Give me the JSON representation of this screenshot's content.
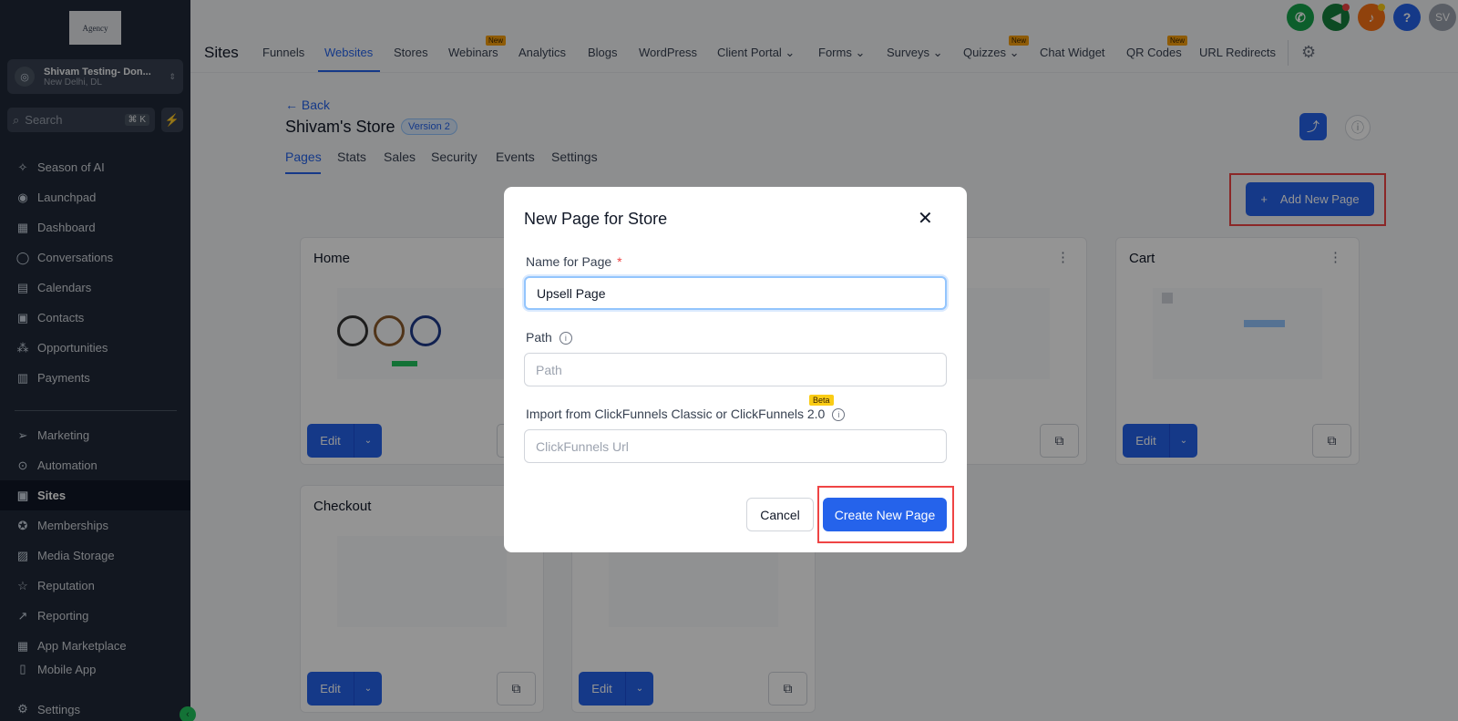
{
  "sidebar": {
    "logo_text": "Agency",
    "account": {
      "name": "Shivam Testing- Don...",
      "location": "New Delhi, DL"
    },
    "search": {
      "placeholder": "Search",
      "shortcut": "⌘ K"
    },
    "items": [
      {
        "label": "Season of AI",
        "icon": "sparkle-icon"
      },
      {
        "label": "Launchpad",
        "icon": "rocket-icon"
      },
      {
        "label": "Dashboard",
        "icon": "grid-icon"
      },
      {
        "label": "Conversations",
        "icon": "chat-icon"
      },
      {
        "label": "Calendars",
        "icon": "calendar-icon"
      },
      {
        "label": "Contacts",
        "icon": "contacts-icon"
      },
      {
        "label": "Opportunities",
        "icon": "funnel-icon"
      },
      {
        "label": "Payments",
        "icon": "payments-icon"
      },
      {
        "label": "Marketing",
        "icon": "send-icon"
      },
      {
        "label": "Automation",
        "icon": "automation-icon"
      },
      {
        "label": "Sites",
        "icon": "sites-icon",
        "active": true
      },
      {
        "label": "Memberships",
        "icon": "badge-icon"
      },
      {
        "label": "Media Storage",
        "icon": "image-icon"
      },
      {
        "label": "Reputation",
        "icon": "star-icon"
      },
      {
        "label": "Reporting",
        "icon": "chart-icon"
      },
      {
        "label": "App Marketplace",
        "icon": "apps-icon"
      },
      {
        "label": "Mobile App",
        "icon": "phone-icon"
      },
      {
        "label": "Settings",
        "icon": "gear-icon"
      }
    ]
  },
  "topbar": {
    "title": "Sites",
    "nav": [
      {
        "label": "Funnels"
      },
      {
        "label": "Websites",
        "active": true
      },
      {
        "label": "Stores"
      },
      {
        "label": "Webinars",
        "badge": "New"
      },
      {
        "label": "Analytics"
      },
      {
        "label": "Blogs"
      },
      {
        "label": "WordPress"
      },
      {
        "label": "Client Portal ⌄"
      },
      {
        "label": "Forms ⌄"
      },
      {
        "label": "Surveys ⌄"
      },
      {
        "label": "Quizzes ⌄",
        "badge": "New"
      },
      {
        "label": "Chat Widget"
      },
      {
        "label": "QR Codes",
        "badge": "New"
      },
      {
        "label": "URL Redirects"
      }
    ],
    "user_initials": "SV",
    "help_glyph": "?"
  },
  "store": {
    "back": "← Back",
    "name": "Shivam's Store",
    "version": "Version 2",
    "tabs": [
      "Pages",
      "Stats",
      "Sales",
      "Security",
      "Events",
      "Settings"
    ],
    "add_page": "Add New Page"
  },
  "cards": [
    {
      "name": "Home"
    },
    {
      "name": ""
    },
    {
      "name": ""
    },
    {
      "name": "Cart"
    },
    {
      "name": "Checkout"
    },
    {
      "name": ""
    }
  ],
  "card_edit": "Edit",
  "modal": {
    "title": "New Page for Store",
    "name_label": "Name for Page",
    "name_required": "*",
    "name_value": "Upsell Page",
    "path_label": "Path",
    "path_placeholder": "Path",
    "import_label": "Import from ClickFunnels Classic or ClickFunnels 2.0",
    "beta": "Beta",
    "import_placeholder": "ClickFunnels Url",
    "cancel": "Cancel",
    "create": "Create New Page"
  },
  "colors": {
    "accent": "#2563eb",
    "highlight": "#ef4444",
    "sidebar": "#1f2937"
  }
}
